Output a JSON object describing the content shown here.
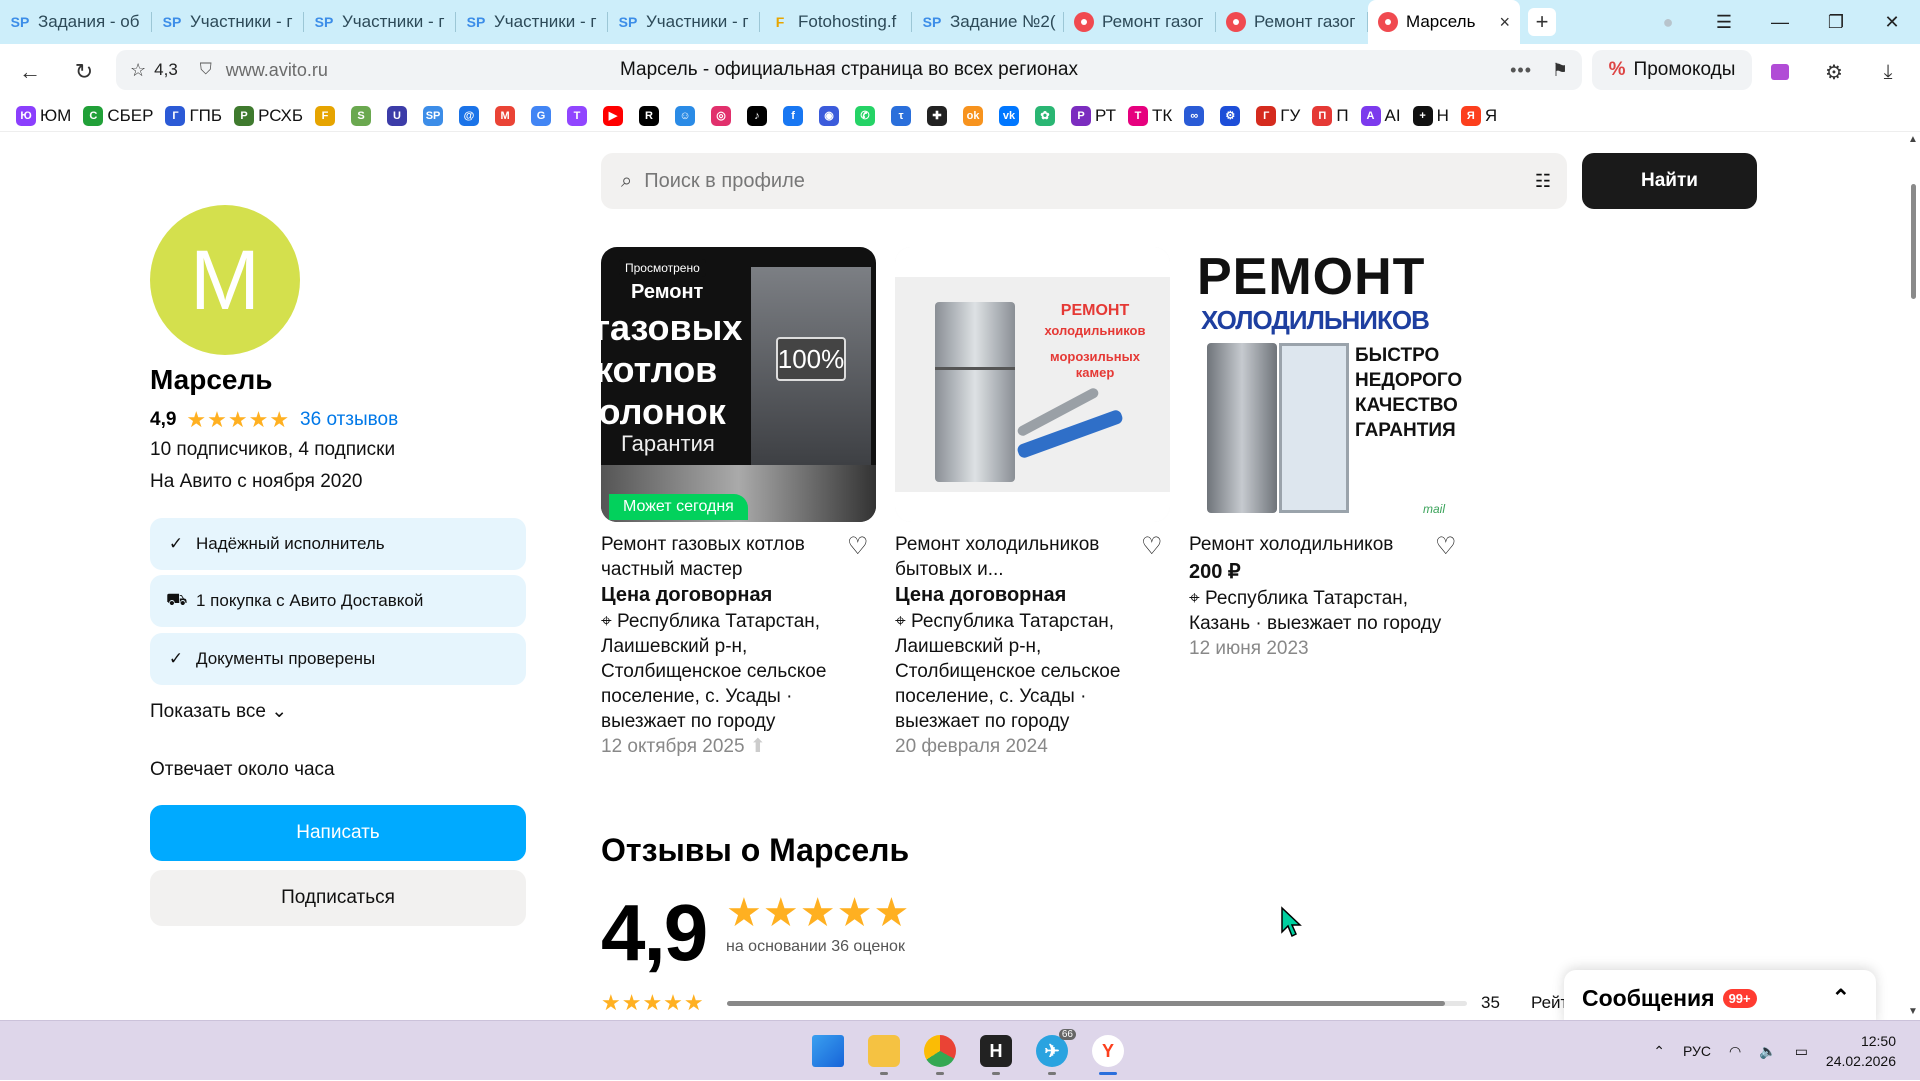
{
  "browser": {
    "tabs": [
      {
        "icon": "sp",
        "label": "Задания - об"
      },
      {
        "icon": "sp",
        "label": "Участники - г"
      },
      {
        "icon": "sp",
        "label": "Участники - г"
      },
      {
        "icon": "sp",
        "label": "Участники - г"
      },
      {
        "icon": "sp",
        "label": "Участники - г"
      },
      {
        "icon": "ft",
        "label": "Fotohosting.f"
      },
      {
        "icon": "sp",
        "label": "Задание №2("
      },
      {
        "icon": "av",
        "label": "Ремонт газог"
      },
      {
        "icon": "av",
        "label": "Ремонт газог"
      },
      {
        "icon": "av",
        "label": "Марсель"
      }
    ],
    "site_rating": "4,3",
    "url": "www.avito.ru",
    "page_title": "Марсель - официальная страница во всех регионах",
    "promo_label": "Промокоды",
    "bookmarks": [
      {
        "label": "ЮМ",
        "color": "#8b3ffd",
        "glyph": "Ю"
      },
      {
        "label": "СБЕР",
        "color": "#21a038",
        "glyph": "С"
      },
      {
        "label": "ГПБ",
        "color": "#2b5ad6",
        "glyph": "Г"
      },
      {
        "label": "РСХБ",
        "color": "#3f7a2e",
        "glyph": "Р"
      },
      {
        "label": "",
        "color": "#e6a400",
        "glyph": "F"
      },
      {
        "label": "",
        "color": "#6aa84f",
        "glyph": "S"
      },
      {
        "label": "",
        "color": "#3c3ca8",
        "glyph": "U"
      },
      {
        "label": "",
        "color": "#3c8de8",
        "glyph": "SP"
      },
      {
        "label": "",
        "color": "#1a73e8",
        "glyph": "@"
      },
      {
        "label": "",
        "color": "#ea4335",
        "glyph": "M"
      },
      {
        "label": "",
        "color": "#4285f4",
        "glyph": "G"
      },
      {
        "label": "",
        "color": "#9146ff",
        "glyph": "T"
      },
      {
        "label": "",
        "color": "#ff0000",
        "glyph": "▶"
      },
      {
        "label": "",
        "color": "#000000",
        "glyph": "R"
      },
      {
        "label": "",
        "color": "#2a8be6",
        "glyph": "☺"
      },
      {
        "label": "",
        "color": "#e1306c",
        "glyph": "◎"
      },
      {
        "label": "",
        "color": "#000000",
        "glyph": "♪"
      },
      {
        "label": "",
        "color": "#1877f2",
        "glyph": "f"
      },
      {
        "label": "",
        "color": "#3b5bdb",
        "glyph": "◉"
      },
      {
        "label": "",
        "color": "#25d366",
        "glyph": "✆"
      },
      {
        "label": "",
        "color": "#2a6fdb",
        "glyph": "τ"
      },
      {
        "label": "",
        "color": "#222222",
        "glyph": "✚"
      },
      {
        "label": "",
        "color": "#f7931e",
        "glyph": "ok"
      },
      {
        "label": "",
        "color": "#0077ff",
        "glyph": "vk"
      },
      {
        "label": "",
        "color": "#2ab673",
        "glyph": "✿"
      },
      {
        "label": "РТ",
        "color": "#7b2cbf",
        "glyph": "Р"
      },
      {
        "label": "ТК",
        "color": "#e6007e",
        "glyph": "Т"
      },
      {
        "label": "",
        "color": "#2a5bd6",
        "glyph": "∞"
      },
      {
        "label": "",
        "color": "#1d4ed8",
        "glyph": "⚙"
      },
      {
        "label": "ГУ",
        "color": "#d52b1e",
        "glyph": "Г"
      },
      {
        "label": "П",
        "color": "#e53935",
        "glyph": "П"
      },
      {
        "label": "AI",
        "color": "#7c3aed",
        "glyph": "A"
      },
      {
        "label": "Н",
        "color": "#111111",
        "glyph": "+"
      },
      {
        "label": "Я",
        "color": "#fc3f1d",
        "glyph": "Я"
      }
    ]
  },
  "profile": {
    "avatar_letter": "М",
    "name": "Марсель",
    "rating": "4,9",
    "stars": "★★★★★",
    "reviews_link": "36 отзывов",
    "followers": "10 подписчиков, 4 подписки",
    "since": "На Авито с ноября 2020",
    "badges": [
      {
        "icon": "check-circle-icon",
        "glyph": "✓",
        "label": "Надёжный исполнитель"
      },
      {
        "icon": "cart-icon",
        "glyph": "🛒",
        "label": "1 покупка с Авито Доставкой"
      },
      {
        "icon": "check-circle-icon",
        "glyph": "✓",
        "label": "Документы проверены"
      }
    ],
    "show_all": "Показать все",
    "response_time": "Отвечает около часа",
    "write_button": "Написать",
    "subscribe_button": "Подписаться"
  },
  "search": {
    "placeholder": "Поиск в профиле",
    "find_button": "Найти"
  },
  "listings": [
    {
      "overlay_viewed": "Просмотрено",
      "overlay_today": "Может сегодня",
      "image_text": [
        "Ремонт",
        "газовых",
        "котлов",
        "колонок",
        "Гарантия",
        "100%"
      ],
      "title": "Ремонт газовых котлов частный мастер",
      "price": "Цена договорная",
      "location": "Республика Татарстан, Лаишевский р-н, Столбищенское сельское поселение, с. Усады · выезжает по городу",
      "date": "12 октября 2025"
    },
    {
      "image_text": [
        "РЕМОНТ",
        "холодильников",
        "морозильных",
        "камер"
      ],
      "title": "Ремонт холодильников бытовых и...",
      "price": "Цена договорная",
      "location": "Республика Татарстан, Лаишевский р-н, Столбищенское сельское поселение, с. Усады · выезжает по городу",
      "date": "20 февраля 2024"
    },
    {
      "image_text": [
        "РЕМОНТ",
        "ХОЛОДИЛЬНИКОВ",
        "БЫСТРО",
        "НЕДОРОГО",
        "КАЧЕСТВО",
        "ГАРАНТИЯ",
        "mail"
      ],
      "title": "Ремонт холодильников",
      "price": "200 ₽",
      "location": "Республика Татарстан, Казань · выезжает по городу",
      "date": "12 июня 2023"
    }
  ],
  "reviews": {
    "title": "Отзывы о Марсель",
    "rating": "4,9",
    "stars": "★★★★★",
    "based_on": "на основании 36 оценок",
    "bars": [
      {
        "stars": "★★★★★",
        "count": "35",
        "fraction": 0.97
      }
    ],
    "tail_text": "Рейт"
  },
  "messages": {
    "label": "Сообщения",
    "count": "99+"
  },
  "taskbar": {
    "language": "РУС",
    "time": "12:50",
    "date": "24.02.2026",
    "telegram_badge": "66"
  }
}
